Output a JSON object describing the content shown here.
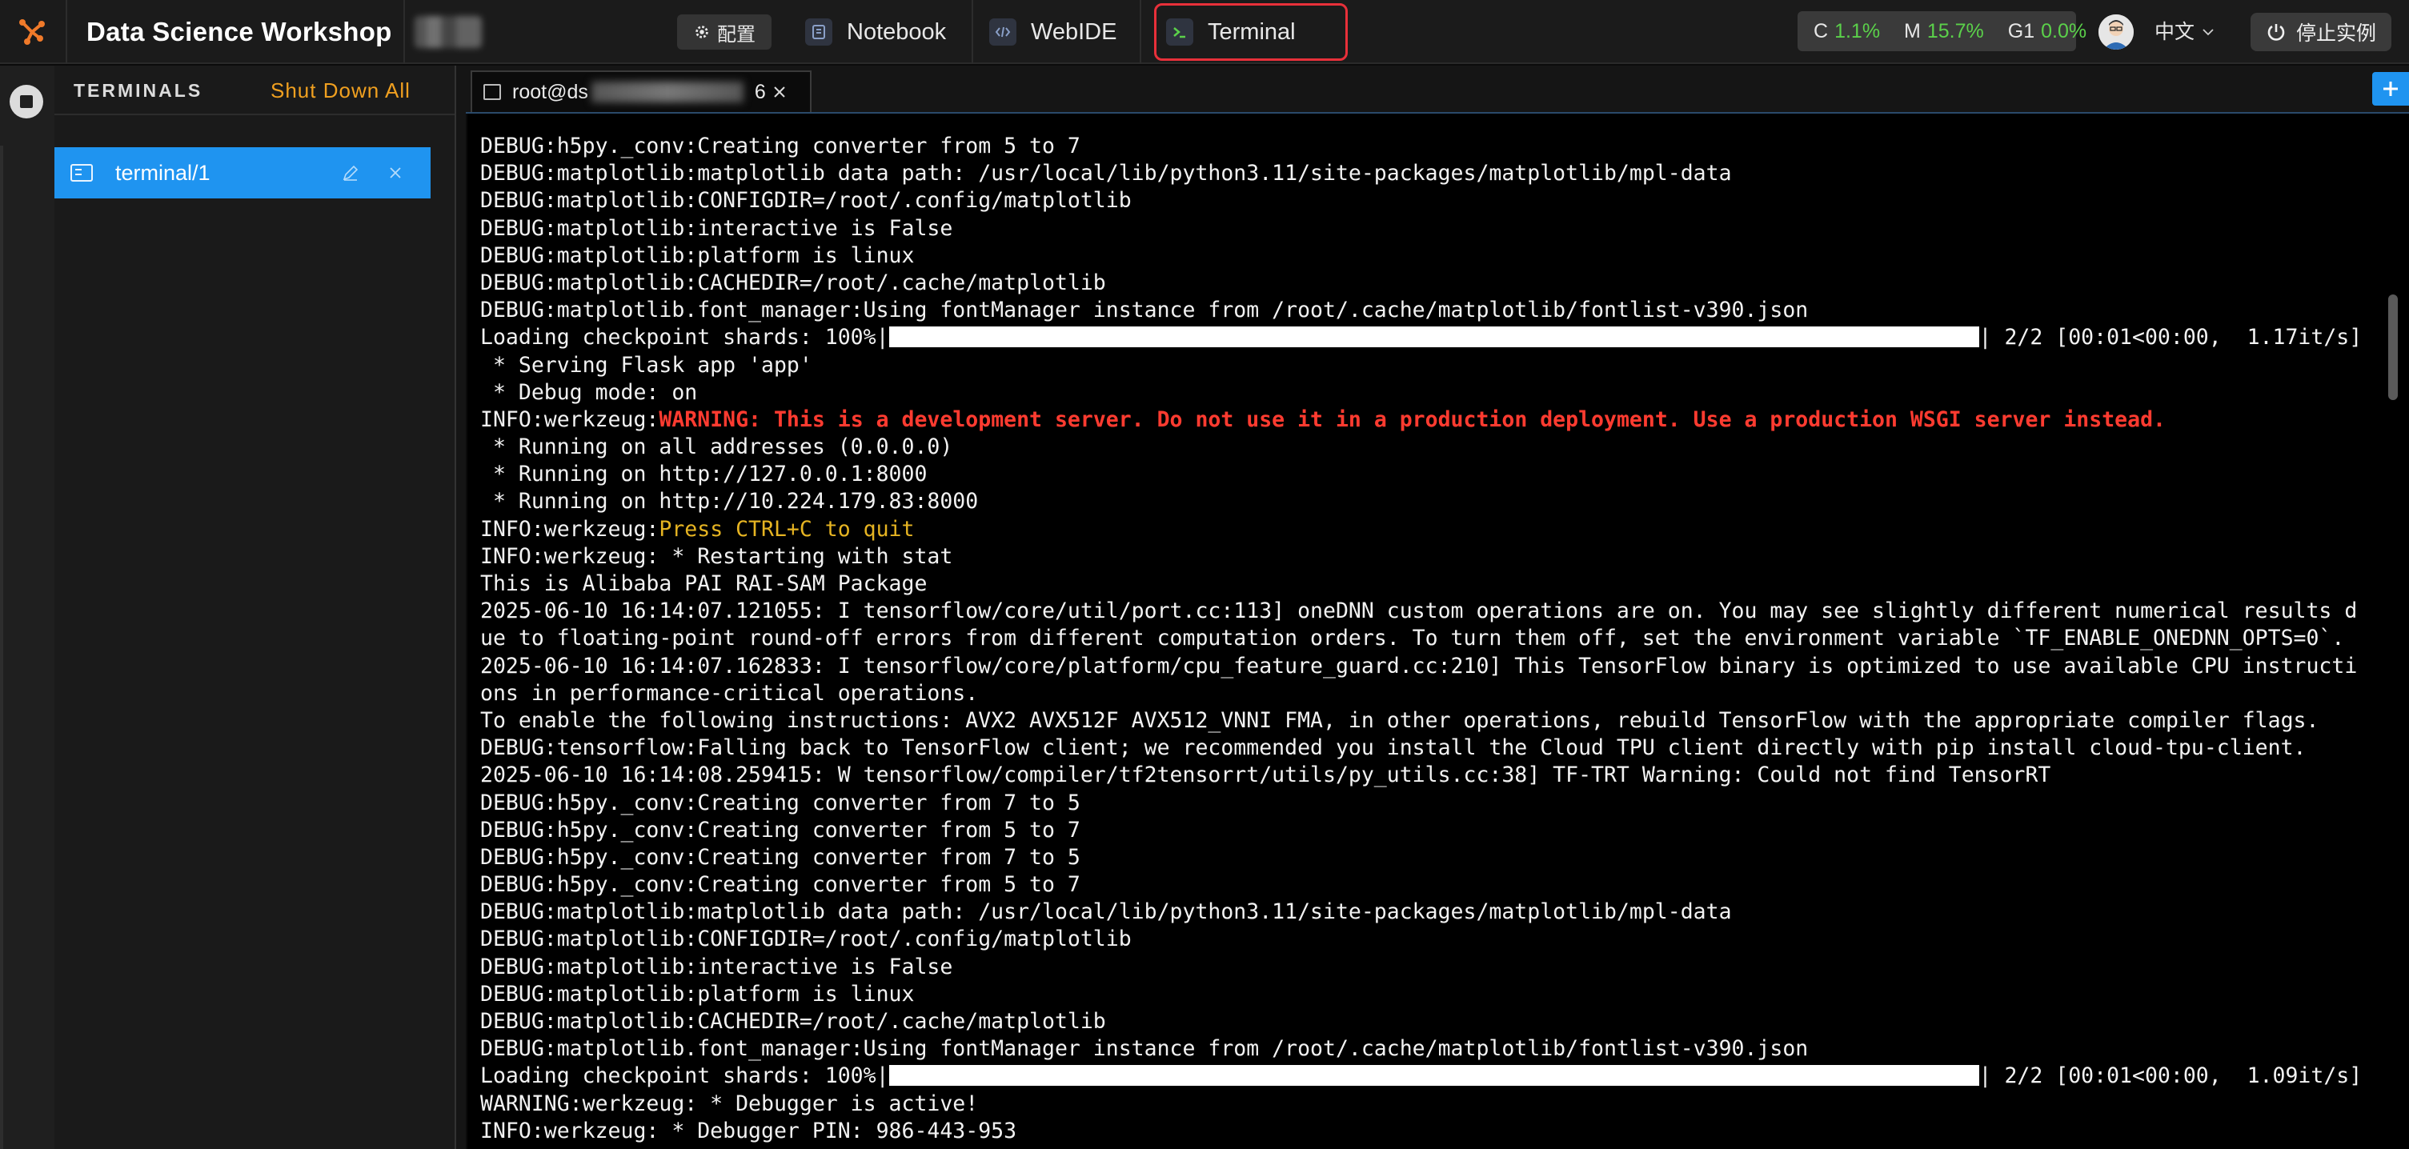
{
  "header": {
    "app_title": "Data Science Workshop",
    "config_label": "配置",
    "tabs": [
      {
        "label": "Notebook",
        "icon": "notebook-icon"
      },
      {
        "label": "WebIDE",
        "icon": "webide-icon"
      },
      {
        "label": "Terminal",
        "icon": "terminal-icon",
        "active": true
      }
    ],
    "usage": {
      "cpu_label": "C",
      "cpu_value": "1.1%",
      "mem_label": "M",
      "mem_value": "15.7%",
      "gpu_label": "G1",
      "gpu_value": "0.0%"
    },
    "language": "中文",
    "stop_label": "停止实例"
  },
  "sidebar": {
    "title": "TERMINALS",
    "shutdown_all": "Shut Down All",
    "items": [
      {
        "label": "terminal/1"
      }
    ]
  },
  "terminal_tab": {
    "prefix": "root@ds",
    "suffix": "6"
  },
  "colors": {
    "accent": "#1f94f0",
    "warning": "#ff3b30",
    "notice": "#e6b422",
    "usage_value": "#5bd14a",
    "highlight_box": "#e8303a"
  },
  "terminal": {
    "lines": [
      {
        "t": "DEBUG:h5py._conv:Creating converter from 5 to 7"
      },
      {
        "t": "DEBUG:matplotlib:matplotlib data path: /usr/local/lib/python3.11/site-packages/matplotlib/mpl-data"
      },
      {
        "t": "DEBUG:matplotlib:CONFIGDIR=/root/.config/matplotlib"
      },
      {
        "t": "DEBUG:matplotlib:interactive is False"
      },
      {
        "t": "DEBUG:matplotlib:platform is linux"
      },
      {
        "t": "DEBUG:matplotlib:CACHEDIR=/root/.cache/matplotlib"
      },
      {
        "t": "DEBUG:matplotlib.font_manager:Using fontManager instance from /root/.cache/matplotlib/fontlist-v390.json"
      },
      {
        "t": "Loading checkpoint shards: 100%|",
        "bar": true,
        "after": "| 2/2 [00:01<00:00,  1.17it/s]"
      },
      {
        "t": " * Serving Flask app 'app'"
      },
      {
        "t": " * Debug mode: on"
      },
      {
        "t": "INFO:werkzeug:",
        "red": "WARNING: This is a development server. Do not use it in a production deployment. Use a production WSGI server instead."
      },
      {
        "t": " * Running on all addresses (0.0.0.0)"
      },
      {
        "t": " * Running on http://127.0.0.1:8000"
      },
      {
        "t": " * Running on http://10.224.179.83:8000"
      },
      {
        "t": "INFO:werkzeug:",
        "yellow": "Press CTRL+C to quit"
      },
      {
        "t": "INFO:werkzeug: * Restarting with stat"
      },
      {
        "t": "This is Alibaba PAI RAI-SAM Package"
      },
      {
        "t": "2025-06-10 16:14:07.121055: I tensorflow/core/util/port.cc:113] oneDNN custom operations are on. You may see slightly different numerical results d"
      },
      {
        "t": "ue to floating-point round-off errors from different computation orders. To turn them off, set the environment variable `TF_ENABLE_ONEDNN_OPTS=0`."
      },
      {
        "t": "2025-06-10 16:14:07.162833: I tensorflow/core/platform/cpu_feature_guard.cc:210] This TensorFlow binary is optimized to use available CPU instructi"
      },
      {
        "t": "ons in performance-critical operations."
      },
      {
        "t": "To enable the following instructions: AVX2 AVX512F AVX512_VNNI FMA, in other operations, rebuild TensorFlow with the appropriate compiler flags."
      },
      {
        "t": "DEBUG:tensorflow:Falling back to TensorFlow client; we recommended you install the Cloud TPU client directly with pip install cloud-tpu-client."
      },
      {
        "t": "2025-06-10 16:14:08.259415: W tensorflow/compiler/tf2tensorrt/utils/py_utils.cc:38] TF-TRT Warning: Could not find TensorRT"
      },
      {
        "t": "DEBUG:h5py._conv:Creating converter from 7 to 5"
      },
      {
        "t": "DEBUG:h5py._conv:Creating converter from 5 to 7"
      },
      {
        "t": "DEBUG:h5py._conv:Creating converter from 7 to 5"
      },
      {
        "t": "DEBUG:h5py._conv:Creating converter from 5 to 7"
      },
      {
        "t": "DEBUG:matplotlib:matplotlib data path: /usr/local/lib/python3.11/site-packages/matplotlib/mpl-data"
      },
      {
        "t": "DEBUG:matplotlib:CONFIGDIR=/root/.config/matplotlib"
      },
      {
        "t": "DEBUG:matplotlib:interactive is False"
      },
      {
        "t": "DEBUG:matplotlib:platform is linux"
      },
      {
        "t": "DEBUG:matplotlib:CACHEDIR=/root/.cache/matplotlib"
      },
      {
        "t": "DEBUG:matplotlib.font_manager:Using fontManager instance from /root/.cache/matplotlib/fontlist-v390.json"
      },
      {
        "t": "Loading checkpoint shards: 100%|",
        "bar": true,
        "after": "| 2/2 [00:01<00:00,  1.09it/s]"
      },
      {
        "t": "WARNING:werkzeug: * Debugger is active!"
      },
      {
        "t": "INFO:werkzeug: * Debugger PIN: 986-443-953"
      }
    ]
  }
}
